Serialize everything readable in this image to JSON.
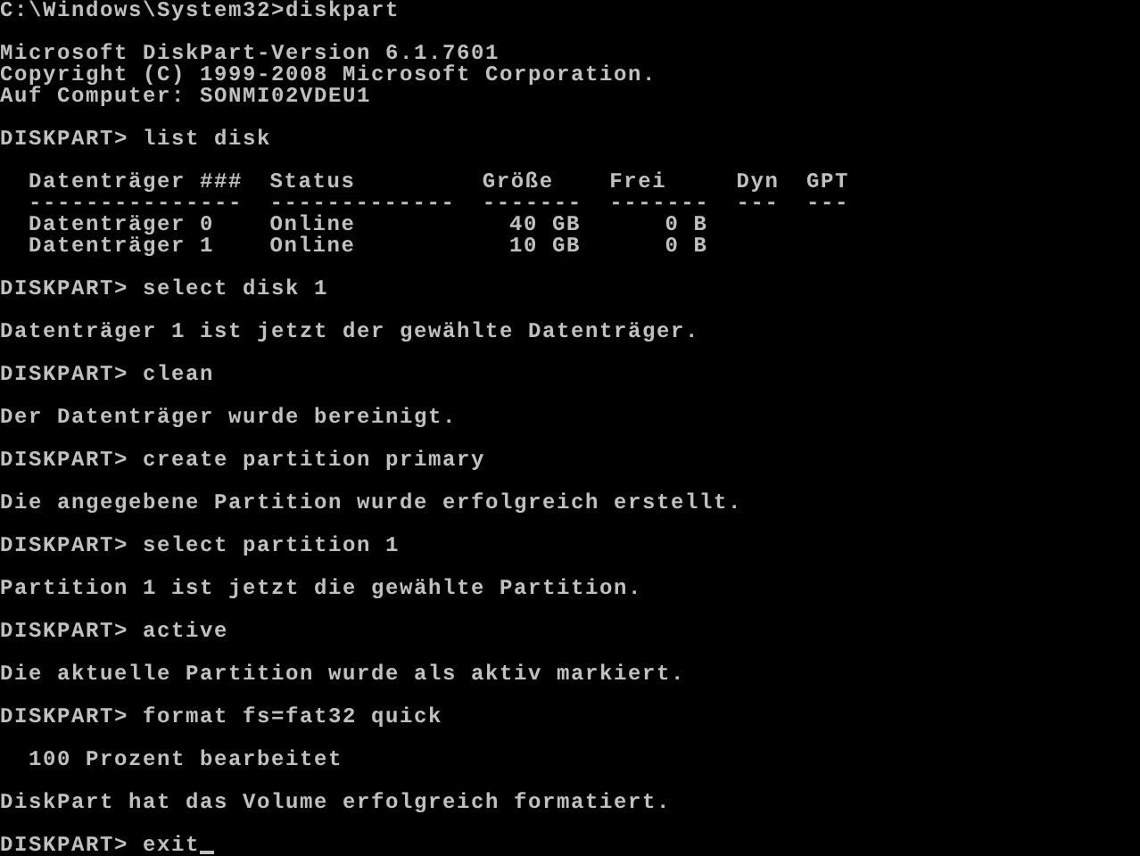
{
  "console": {
    "entries": [
      {
        "kind": "prompt",
        "text": "C:\\Windows\\System32>diskpart"
      },
      {
        "kind": "blank"
      },
      {
        "kind": "output",
        "text": "Microsoft DiskPart-Version 6.1.7601"
      },
      {
        "kind": "output",
        "text": "Copyright (C) 1999-2008 Microsoft Corporation."
      },
      {
        "kind": "output",
        "text": "Auf Computer: SONMI02VDEU1"
      },
      {
        "kind": "blank"
      },
      {
        "kind": "prompt",
        "text": "DISKPART> list disk"
      },
      {
        "kind": "blank"
      },
      {
        "kind": "table",
        "columns": [
          {
            "heading": "Datenträger ###",
            "rule": "---------------",
            "kind": "text"
          },
          {
            "heading": "Status",
            "rule": "-------------",
            "kind": "text"
          },
          {
            "heading": "Größe",
            "rule": "-------",
            "kind": "number"
          },
          {
            "heading": "Frei",
            "rule": "-------",
            "kind": "number"
          },
          {
            "heading": "Dyn",
            "rule": "---",
            "kind": "text"
          },
          {
            "heading": "GPT",
            "rule": "---",
            "kind": "text"
          }
        ],
        "rows": [
          [
            "Datenträger 0",
            "Online",
            "40 GB",
            "0 B",
            "",
            ""
          ],
          [
            "Datenträger 1",
            "Online",
            "10 GB",
            "0 B",
            "",
            ""
          ]
        ]
      },
      {
        "kind": "blank"
      },
      {
        "kind": "prompt",
        "text": "DISKPART> select disk 1"
      },
      {
        "kind": "blank"
      },
      {
        "kind": "output",
        "text": "Datenträger 1 ist jetzt der gewählte Datenträger."
      },
      {
        "kind": "blank"
      },
      {
        "kind": "prompt",
        "text": "DISKPART> clean"
      },
      {
        "kind": "blank"
      },
      {
        "kind": "output",
        "text": "Der Datenträger wurde bereinigt."
      },
      {
        "kind": "blank"
      },
      {
        "kind": "prompt",
        "text": "DISKPART> create partition primary"
      },
      {
        "kind": "blank"
      },
      {
        "kind": "output",
        "text": "Die angegebene Partition wurde erfolgreich erstellt."
      },
      {
        "kind": "blank"
      },
      {
        "kind": "prompt",
        "text": "DISKPART> select partition 1"
      },
      {
        "kind": "blank"
      },
      {
        "kind": "output",
        "text": "Partition 1 ist jetzt die gewählte Partition."
      },
      {
        "kind": "blank"
      },
      {
        "kind": "prompt",
        "text": "DISKPART> active"
      },
      {
        "kind": "blank"
      },
      {
        "kind": "output",
        "text": "Die aktuelle Partition wurde als aktiv markiert."
      },
      {
        "kind": "blank"
      },
      {
        "kind": "prompt",
        "text": "DISKPART> format fs=fat32 quick"
      },
      {
        "kind": "blank"
      },
      {
        "kind": "progress",
        "text": "100 Prozent bearbeitet"
      },
      {
        "kind": "blank"
      },
      {
        "kind": "output",
        "text": "DiskPart hat das Volume erfolgreich formatiert."
      },
      {
        "kind": "blank"
      },
      {
        "kind": "prompt",
        "text": "DISKPART> exit",
        "cursor": true
      }
    ]
  }
}
